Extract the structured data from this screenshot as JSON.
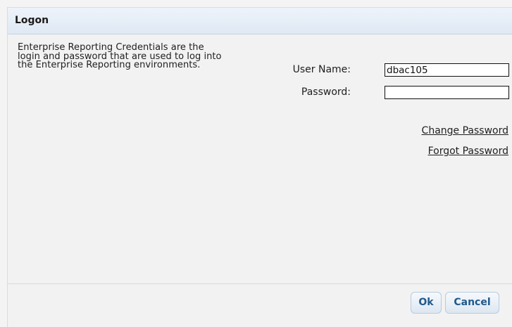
{
  "dialog": {
    "title": "Logon",
    "description": "Enterprise Reporting Credentials are the login and password that are used to log into the Enterprise Reporting environments."
  },
  "form": {
    "user_name_label": "User Name:",
    "user_name_value": "dbac105",
    "password_label": "Password:",
    "password_value": ""
  },
  "links": {
    "change_password": "Change Password",
    "forgot_password": "Forgot Password"
  },
  "buttons": {
    "ok": "Ok",
    "cancel": "Cancel"
  },
  "colors": {
    "title_bar": "#e6eef7",
    "button_text": "#1f5a8c"
  }
}
